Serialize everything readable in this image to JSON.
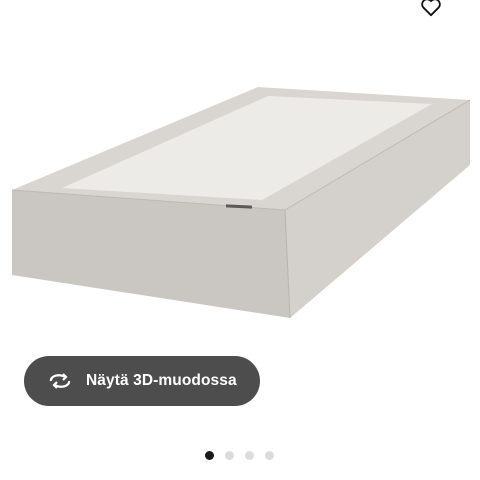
{
  "product": {
    "image_icon": "mattress-base-image"
  },
  "favorite": {
    "icon": "heart-icon"
  },
  "view3d": {
    "label": "Näytä 3D-muodossa",
    "icon": "rotate-icon"
  },
  "carousel": {
    "slides": 4,
    "active_index": 0
  },
  "colors": {
    "button_bg": "#4d4d4d",
    "dot_active": "#1a1a1a",
    "dot_inactive": "#dcdcdc"
  }
}
